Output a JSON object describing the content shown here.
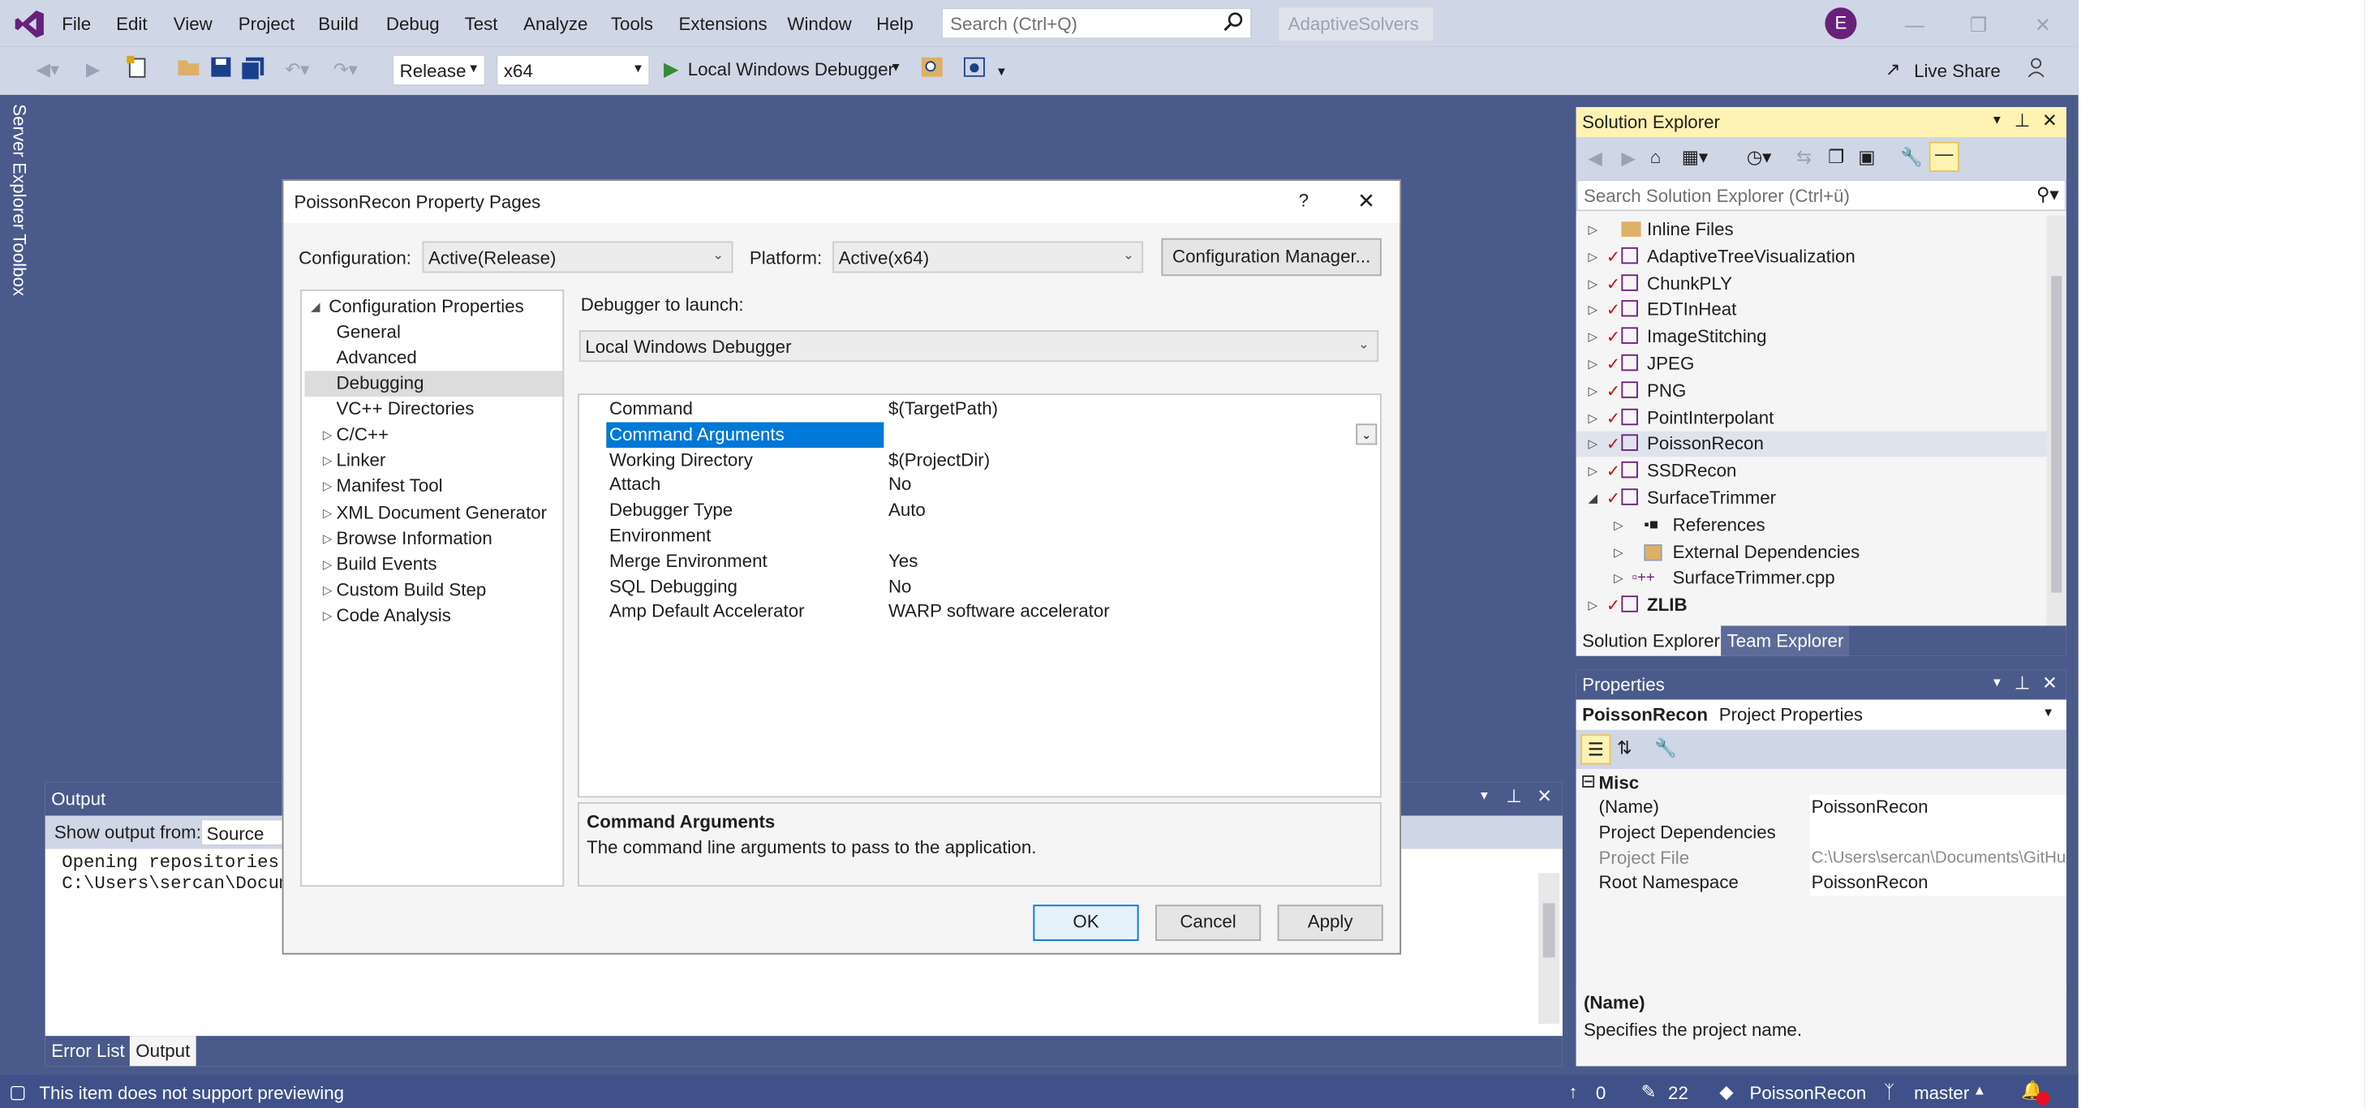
{
  "menu": {
    "items": [
      "File",
      "Edit",
      "View",
      "Project",
      "Build",
      "Debug",
      "Test",
      "Analyze",
      "Tools",
      "Extensions",
      "Window",
      "Help"
    ],
    "search_placeholder": "Search (Ctrl+Q)",
    "solution_name": "AdaptiveSolvers",
    "avatar_initial": "E"
  },
  "toolbar": {
    "configuration": "Release",
    "platform": "x64",
    "debugger": "Local Windows Debugger",
    "live_share": "Live Share"
  },
  "side_tabs": {
    "server_explorer": "Server Explorer",
    "toolbox": "Toolbox"
  },
  "dialog": {
    "title": "PoissonRecon Property Pages",
    "help": "?",
    "configuration_label": "Configuration:",
    "configuration_value": "Active(Release)",
    "platform_label": "Platform:",
    "platform_value": "Active(x64)",
    "config_manager": "Configuration Manager...",
    "debugger_label": "Debugger to launch:",
    "debugger_value": "Local Windows Debugger",
    "tree": {
      "root": "Configuration Properties",
      "children": [
        "General",
        "Advanced",
        "Debugging",
        "VC++ Directories"
      ],
      "expandable": [
        "C/C++",
        "Linker",
        "Manifest Tool",
        "XML Document Generator",
        "Browse Information",
        "Build Events",
        "Custom Build Step",
        "Code Analysis"
      ]
    },
    "grid": [
      [
        "Command",
        "$(TargetPath)"
      ],
      [
        "Command Arguments",
        ""
      ],
      [
        "Working Directory",
        "$(ProjectDir)"
      ],
      [
        "Attach",
        "No"
      ],
      [
        "Debugger Type",
        "Auto"
      ],
      [
        "Environment",
        ""
      ],
      [
        "Merge Environment",
        "Yes"
      ],
      [
        "SQL Debugging",
        "No"
      ],
      [
        "Amp Default Accelerator",
        "WARP software accelerator"
      ]
    ],
    "desc_title": "Command Arguments",
    "desc_text": "The command line arguments to pass to the application.",
    "ok": "OK",
    "cancel": "Cancel",
    "apply": "Apply"
  },
  "output": {
    "title": "Output",
    "show_from_label": "Show output from:",
    "source": "Source Co",
    "lines": [
      "Opening repositories:",
      "C:\\Users\\sercan\\Documen"
    ],
    "tabs": [
      "Error List",
      "Output"
    ]
  },
  "solution_explorer": {
    "title": "Solution Explorer",
    "search_placeholder": "Search Solution Explorer (Ctrl+ü)",
    "items": [
      "Inline Files",
      "AdaptiveTreeVisualization",
      "ChunkPLY",
      "EDTInHeat",
      "ImageStitching",
      "JPEG",
      "PNG",
      "PointInterpolant",
      "PoissonRecon",
      "SSDRecon",
      "SurfaceTrimmer",
      "References",
      "External Dependencies",
      "SurfaceTrimmer.cpp",
      "ZLIB"
    ],
    "tabs": [
      "Solution Explorer",
      "Team Explorer"
    ]
  },
  "properties": {
    "title": "Properties",
    "object": "PoissonRecon",
    "object_type": "Project Properties",
    "category": "Misc",
    "rows": [
      [
        "(Name)",
        "PoissonRecon"
      ],
      [
        "Project Dependencies",
        ""
      ],
      [
        "Project File",
        "C:\\Users\\sercan\\Documents\\GitHu"
      ],
      [
        "Root Namespace",
        "PoissonRecon"
      ]
    ],
    "desc_title": "(Name)",
    "desc_text": "Specifies the project name."
  },
  "status": {
    "message": "This item does not support previewing",
    "up": "0",
    "edits": "22",
    "repo": "PoissonRecon",
    "branch": "master"
  },
  "colors": {
    "accent": "#0078d7",
    "vs_purple": "#68217a",
    "frame": "#4a5a8a"
  }
}
